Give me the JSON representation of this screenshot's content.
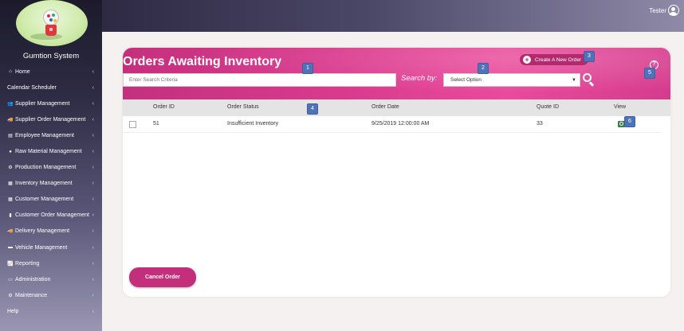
{
  "app": {
    "system_name": "Gumtion System",
    "user_name": "Tester"
  },
  "sidebar": {
    "items": [
      {
        "label": "Home",
        "icon": "home-icon",
        "glyph": "⌂"
      },
      {
        "label": "Calendar Scheduler",
        "icon": "",
        "glyph": ""
      },
      {
        "label": "Supplier Management",
        "icon": "users-icon",
        "glyph": "👥"
      },
      {
        "label": "Supplier Order Management",
        "icon": "truck-icon",
        "glyph": "🚚"
      },
      {
        "label": "Employee Management",
        "icon": "id-card-icon",
        "glyph": "▤"
      },
      {
        "label": "Raw Material Management",
        "icon": "leaf-icon",
        "glyph": "●"
      },
      {
        "label": "Production Management",
        "icon": "cogs-icon",
        "glyph": "⚙"
      },
      {
        "label": "Inventory Management",
        "icon": "list-icon",
        "glyph": "▦"
      },
      {
        "label": "Customer Management",
        "icon": "table-icon",
        "glyph": "▦"
      },
      {
        "label": "Customer Order Management",
        "icon": "file-icon",
        "glyph": "▮"
      },
      {
        "label": "Delivery Management",
        "icon": "truck-icon",
        "glyph": "🚚"
      },
      {
        "label": "Vehicle Management",
        "icon": "car-icon",
        "glyph": "▬"
      },
      {
        "label": "Reporting",
        "icon": "chart-icon",
        "glyph": "📈"
      },
      {
        "label": "Administration",
        "icon": "laptop-icon",
        "glyph": "▭"
      },
      {
        "label": "Maintenance",
        "icon": "gear-icon",
        "glyph": "⚙"
      },
      {
        "label": "Help",
        "icon": "",
        "glyph": ""
      }
    ],
    "chevron": "‹"
  },
  "page": {
    "title": "Orders Awaiting Inventory",
    "search_placeholder": "Enter Search Criteria",
    "search_by_label": "Search by:",
    "select_value": "Select Option",
    "new_order_label": "Create A New Order",
    "help_glyph": "?",
    "cancel_label": "Cancel Order"
  },
  "table": {
    "columns": [
      "Order ID",
      "Order Status",
      "Order Date",
      "Quote ID",
      "View"
    ],
    "rows": [
      {
        "order_id": "51",
        "status": "Insufficient Inventory",
        "date": "9/25/2019 12:00:00 AM",
        "quote_id": "33"
      }
    ]
  },
  "markers": [
    "1",
    "2",
    "3",
    "4",
    "5",
    "6"
  ],
  "colors": {
    "accent": "#da3a8d",
    "marker": "#4f73b8",
    "view_button": "#3d7d47"
  }
}
